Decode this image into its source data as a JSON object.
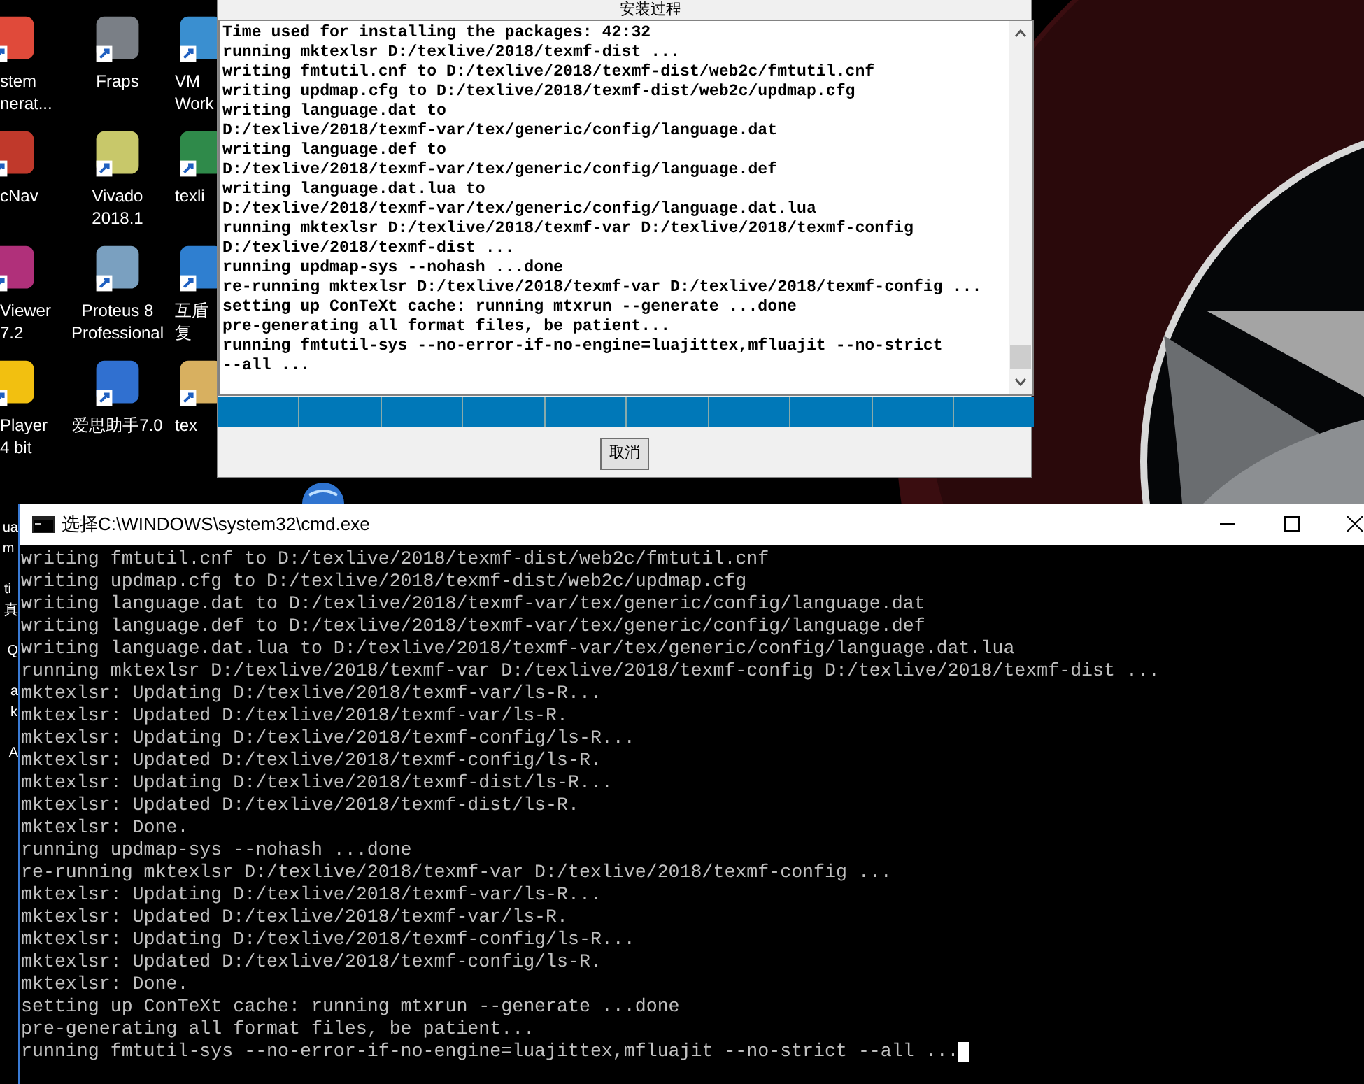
{
  "desktop_icons": [
    {
      "lines": [
        "stem",
        "nerat..."
      ]
    },
    {
      "lines": [
        "Fraps"
      ]
    },
    {
      "lines": [
        "VM",
        "Work"
      ]
    },
    {
      "lines": [
        "cNav"
      ]
    },
    {
      "lines": [
        "Vivado",
        "2018.1"
      ]
    },
    {
      "lines": [
        "texli"
      ]
    },
    {
      "lines": [
        "Viewer",
        "7.2"
      ]
    },
    {
      "lines": [
        "Proteus 8",
        "Professional"
      ]
    },
    {
      "lines": [
        "互盾",
        "复"
      ]
    },
    {
      "lines": [
        "Player",
        "4 bit"
      ]
    },
    {
      "lines": [
        "爱思助手7.0"
      ]
    },
    {
      "lines": [
        "tex"
      ]
    }
  ],
  "strip_icons": [
    {
      "lines": [
        "ua",
        "m"
      ]
    },
    {
      "lines": [
        "ti",
        "真"
      ]
    },
    {
      "lines": [
        "Q"
      ]
    },
    {
      "lines": [
        "a",
        "k"
      ]
    },
    {
      "lines": [
        "A"
      ]
    }
  ],
  "installer": {
    "title": "安装过程",
    "log": [
      "Time used for installing the packages: 42:32",
      "running mktexlsr D:/texlive/2018/texmf-dist ...",
      "writing fmtutil.cnf to D:/texlive/2018/texmf-dist/web2c/fmtutil.cnf",
      "writing updmap.cfg to D:/texlive/2018/texmf-dist/web2c/updmap.cfg",
      "writing language.dat to",
      "D:/texlive/2018/texmf-var/tex/generic/config/language.dat",
      "writing language.def to",
      "D:/texlive/2018/texmf-var/tex/generic/config/language.def",
      "writing language.dat.lua to",
      "D:/texlive/2018/texmf-var/tex/generic/config/language.dat.lua",
      "running mktexlsr D:/texlive/2018/texmf-var D:/texlive/2018/texmf-config",
      "D:/texlive/2018/texmf-dist ...",
      "running updmap-sys --nohash ...done",
      "re-running mktexlsr D:/texlive/2018/texmf-var D:/texlive/2018/texmf-config ...",
      "setting up ConTeXt cache: running mtxrun --generate ...done",
      "pre-generating all format files, be patient...",
      "running fmtutil-sys --no-error-if-no-engine=luajittex,mfluajit --no-strict",
      "--all ..."
    ],
    "cancel_button": "取消"
  },
  "console": {
    "title": "选择C:\\WINDOWS\\system32\\cmd.exe",
    "cursor": true,
    "lines": [
      "writing fmtutil.cnf to D:/texlive/2018/texmf-dist/web2c/fmtutil.cnf",
      "writing updmap.cfg to D:/texlive/2018/texmf-dist/web2c/updmap.cfg",
      "writing language.dat to D:/texlive/2018/texmf-var/tex/generic/config/language.dat",
      "writing language.def to D:/texlive/2018/texmf-var/tex/generic/config/language.def",
      "writing language.dat.lua to D:/texlive/2018/texmf-var/tex/generic/config/language.dat.lua",
      "running mktexlsr D:/texlive/2018/texmf-var D:/texlive/2018/texmf-config D:/texlive/2018/texmf-dist ...",
      "mktexlsr: Updating D:/texlive/2018/texmf-var/ls-R...",
      "mktexlsr: Updated D:/texlive/2018/texmf-var/ls-R.",
      "mktexlsr: Updating D:/texlive/2018/texmf-config/ls-R...",
      "mktexlsr: Updated D:/texlive/2018/texmf-config/ls-R.",
      "mktexlsr: Updating D:/texlive/2018/texmf-dist/ls-R...",
      "mktexlsr: Updated D:/texlive/2018/texmf-dist/ls-R.",
      "mktexlsr: Done.",
      "running updmap-sys --nohash ...done",
      "re-running mktexlsr D:/texlive/2018/texmf-var D:/texlive/2018/texmf-config ...",
      "mktexlsr: Updating D:/texlive/2018/texmf-var/ls-R...",
      "mktexlsr: Updated D:/texlive/2018/texmf-var/ls-R.",
      "mktexlsr: Updating D:/texlive/2018/texmf-config/ls-R...",
      "mktexlsr: Updated D:/texlive/2018/texmf-config/ls-R.",
      "mktexlsr: Done.",
      "setting up ConTeXt cache: running mtxrun --generate ...done",
      "pre-generating all format files, be patient...",
      "running fmtutil-sys --no-error-if-no-engine=luajittex,mfluajit --no-strict --all ..."
    ]
  }
}
